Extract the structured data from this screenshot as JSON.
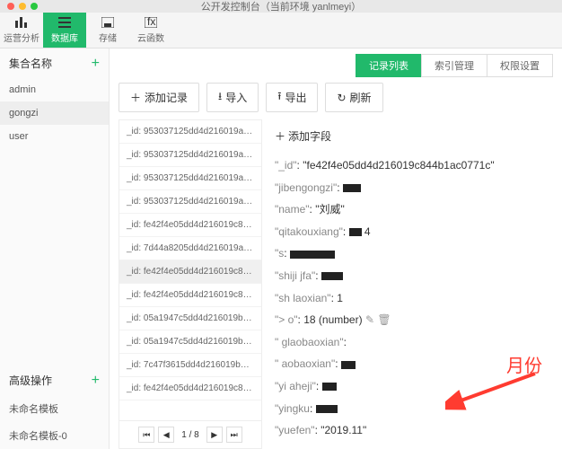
{
  "titlebar": {
    "title": "公开发控制台（当前环境 yanlmeyi）"
  },
  "toolbar": {
    "items": [
      {
        "label": "运营分析",
        "icon": "bars"
      },
      {
        "label": "数据库",
        "icon": "list",
        "active": true
      },
      {
        "label": "存储",
        "icon": "save"
      },
      {
        "label": "云函数",
        "icon": "fn"
      }
    ]
  },
  "sidebar": {
    "collections_header": "集合名称",
    "collections": [
      "admin",
      "gongzi",
      "user"
    ],
    "selected": "gongzi",
    "adv_header": "高级操作",
    "templates": [
      "未命名模板",
      "未命名模板-0"
    ]
  },
  "tabs": [
    {
      "label": "记录列表",
      "active": true
    },
    {
      "label": "索引管理"
    },
    {
      "label": "权限设置"
    }
  ],
  "actions": {
    "add": "添加记录",
    "import": "导入",
    "export": "导出",
    "refresh": "刷新"
  },
  "records": [
    "_id: 953037125dd4d216019aa7a...",
    "_id: 953037125dd4d216019aa7a...",
    "_id: 953037125dd4d216019aa7a...",
    "_id: 953037125dd4d216019aa7a...",
    "_id: fe42f4e05dd4d216019c844...",
    "_id: 7d44a8205dd4d216019aa9...",
    "_id: fe42f4e05dd4d216019c844...",
    "_id: fe42f4e05dd4d216019c844...",
    "_id: 05a1947c5dd4d216019b670...",
    "_id: 05a1947c5dd4d216019b670...",
    "_id: 7c47f3615dd4d216019b414...",
    "_id: fe42f4e05dd4d216019c844..."
  ],
  "selected_record_index": 6,
  "pager": {
    "text": "1 / 8"
  },
  "detail": {
    "add_field": "添加字段",
    "fields": [
      {
        "k": "\"_id\"",
        "v": "\"fe42f4e05dd4d216019c844b1ac0771c\""
      },
      {
        "k": "\"jibengongzi\"",
        "v": "",
        "redact": 20
      },
      {
        "k": "\"name\"",
        "v": "\"刘威\""
      },
      {
        "k": "\"qitakouxiang\"",
        "v": "4",
        "redact": 14,
        "pre": true
      },
      {
        "k": "\"s",
        "v": "",
        "redact": 50
      },
      {
        "k": "\"shiji    jfa\"",
        "v": "",
        "redact": 24
      },
      {
        "k": "\"sh   laoxian\"",
        "v": "1",
        "redact": 0
      },
      {
        "k": "\">    o\"",
        "v": "18 (number)",
        "icons": true
      },
      {
        "k": "\"   glaobaoxian\"",
        "v": "",
        "redact": 0
      },
      {
        "k": "\"   aobaoxian\"",
        "v": "",
        "redact": 16
      },
      {
        "k": "\"yi   aheji\"",
        "v": "",
        "redact": 16
      },
      {
        "k": "\"yingku",
        "v": "",
        "redact": 24
      },
      {
        "k": "\"yuefen\"",
        "v": "\"2019.11\"",
        "highlight": true
      }
    ]
  },
  "annotation": {
    "label": "月份"
  }
}
